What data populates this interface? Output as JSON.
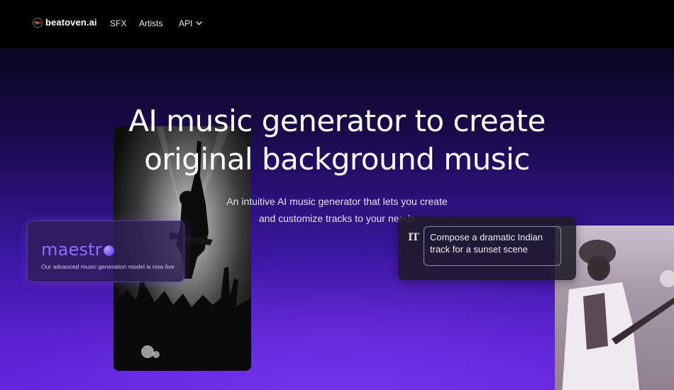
{
  "nav": {
    "brand": "beatoven.ai",
    "links": [
      "SFX",
      "Artists"
    ],
    "api_label": "API"
  },
  "hero": {
    "title_line1": "AI music generator to create",
    "title_line2": "original background music",
    "subtitle_line1": "An intuitive AI music generator that lets you create",
    "subtitle_line2": "and customize tracks to your needs"
  },
  "maestro_card": {
    "word": "maestr",
    "caption": "Our advanced music generation model is now live"
  },
  "prompt_card": {
    "icon_text": "IT",
    "prompt": "Compose a dramatic Indian track for a sunset scene"
  },
  "colors": {
    "nav_bg": "#000000",
    "hero_top": "#0a0624",
    "hero_bottom": "#6426de",
    "maestro_accent": "#8f6cff"
  },
  "icons": {
    "brand": "beatoven-logo-icon",
    "api_caret": "chevron-down-icon",
    "prompt": "text-prompt-icon"
  }
}
